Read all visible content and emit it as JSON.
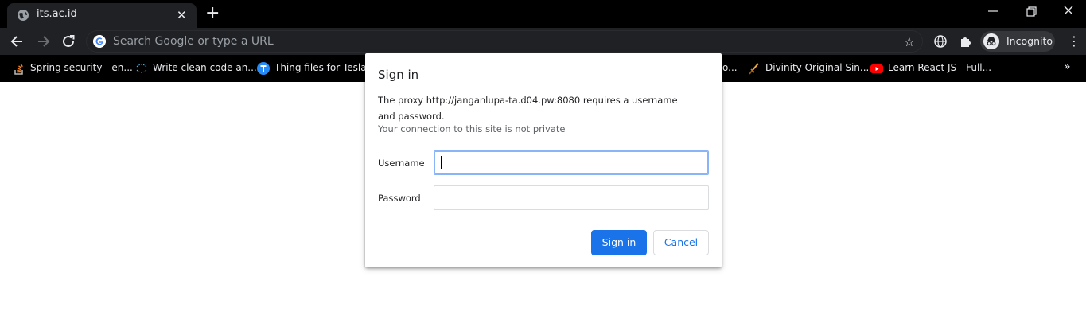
{
  "tab": {
    "title": "its.ac.id",
    "favicon": "globe-icon"
  },
  "omnibox": {
    "placeholder": "Search Google or type a URL"
  },
  "profile": {
    "label": "Incognito"
  },
  "bookmarks": [
    {
      "label": "Spring security - en...",
      "icon": "stackoverflow-icon"
    },
    {
      "label": "Write clean code an...",
      "icon": "site-dots-icon"
    },
    {
      "label": "Thing files for Tesla...",
      "icon": "thingiverse-icon"
    },
    {
      "label": "o...",
      "icon": ""
    },
    {
      "label": "Divinity Original Sin...",
      "icon": "sword-icon"
    },
    {
      "label": "Learn React JS - Full...",
      "icon": "youtube-icon"
    }
  ],
  "dialog": {
    "title": "Sign in",
    "message": "The proxy http://janganlupa-ta.d04.pw:8080 requires a username and password.",
    "note": "Your connection to this site is not private",
    "username_label": "Username",
    "password_label": "Password",
    "username_value": "",
    "password_value": "",
    "signin_label": "Sign in",
    "cancel_label": "Cancel"
  },
  "colors": {
    "accent": "#1a73e8",
    "chrome_bg": "#000000",
    "toolbar_bg": "#202124"
  }
}
